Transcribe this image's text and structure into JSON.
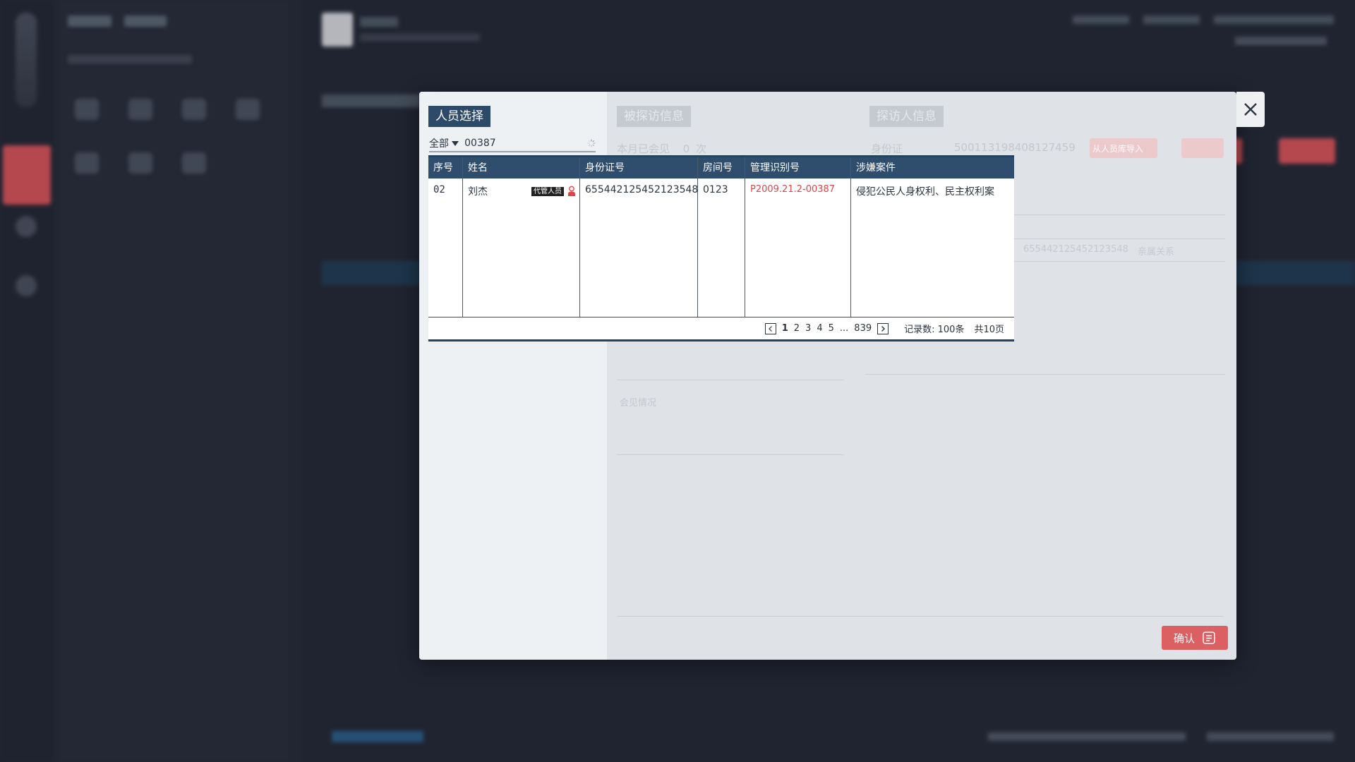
{
  "modal": {
    "title": "人员选择",
    "tab_visited": "被探访信息",
    "tab_visitor": "探访人信息",
    "visited_month_text": "本月已会见",
    "visited_count": "0",
    "visited_count_unit": "次",
    "meeting_label": "会见情况",
    "visitor_idtype": "身份证",
    "visitor_idno": "500113198408127459",
    "faded_button": "从人员库导入",
    "faded_idno_row": "655442125452123548",
    "faded_relation": "亲属关系",
    "confirm_label": "确认"
  },
  "filter": {
    "select_value": "全部",
    "query_value": "00387"
  },
  "table": {
    "headers": [
      "序号",
      "姓名",
      "身份证号",
      "房间号",
      "管理识别号",
      "涉嫌案件"
    ],
    "rows": [
      {
        "index": "02",
        "name": "刘杰",
        "badge": "代管人员",
        "id_no": "655442125452123548",
        "room": "0123",
        "manage_id": "P2009.21.2-00387",
        "case": "侵犯公民人身权利、民主权利案"
      }
    ]
  },
  "pager": {
    "pages": [
      "1",
      "2",
      "3",
      "4",
      "5"
    ],
    "ellipsis": "...",
    "last_page": "839",
    "records_text": "记录数: 100条",
    "total_pages_text": "共10页"
  },
  "colors": {
    "accent_dark": "#2f4d6c",
    "confirm_red": "#dc5f62",
    "manage_id_red": "#e0454a"
  }
}
